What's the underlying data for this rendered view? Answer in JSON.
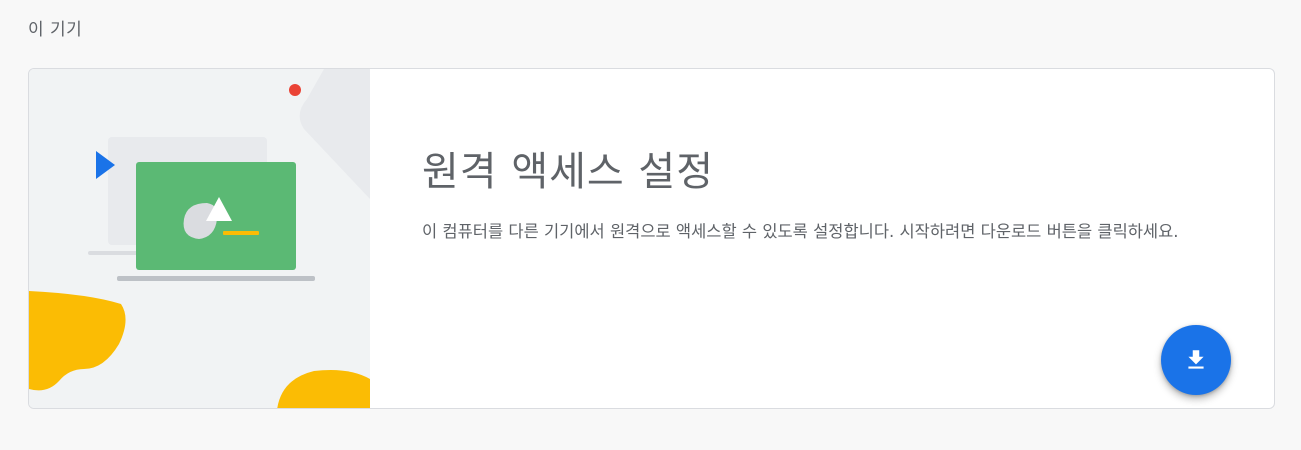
{
  "section": {
    "title": "이 기기"
  },
  "setup_card": {
    "title": "원격 액세스 설정",
    "description": "이 컴퓨터를 다른 기기에서 원격으로 액세스할 수 있도록 설정합니다. 시작하려면 다운로드 버튼을 클릭하세요.",
    "download_button_icon": "download-icon"
  },
  "colors": {
    "accent_blue": "#1a73e8",
    "screen_green": "#5bb974",
    "blob_yellow": "#fbbc04",
    "dot_red": "#ea4335"
  }
}
